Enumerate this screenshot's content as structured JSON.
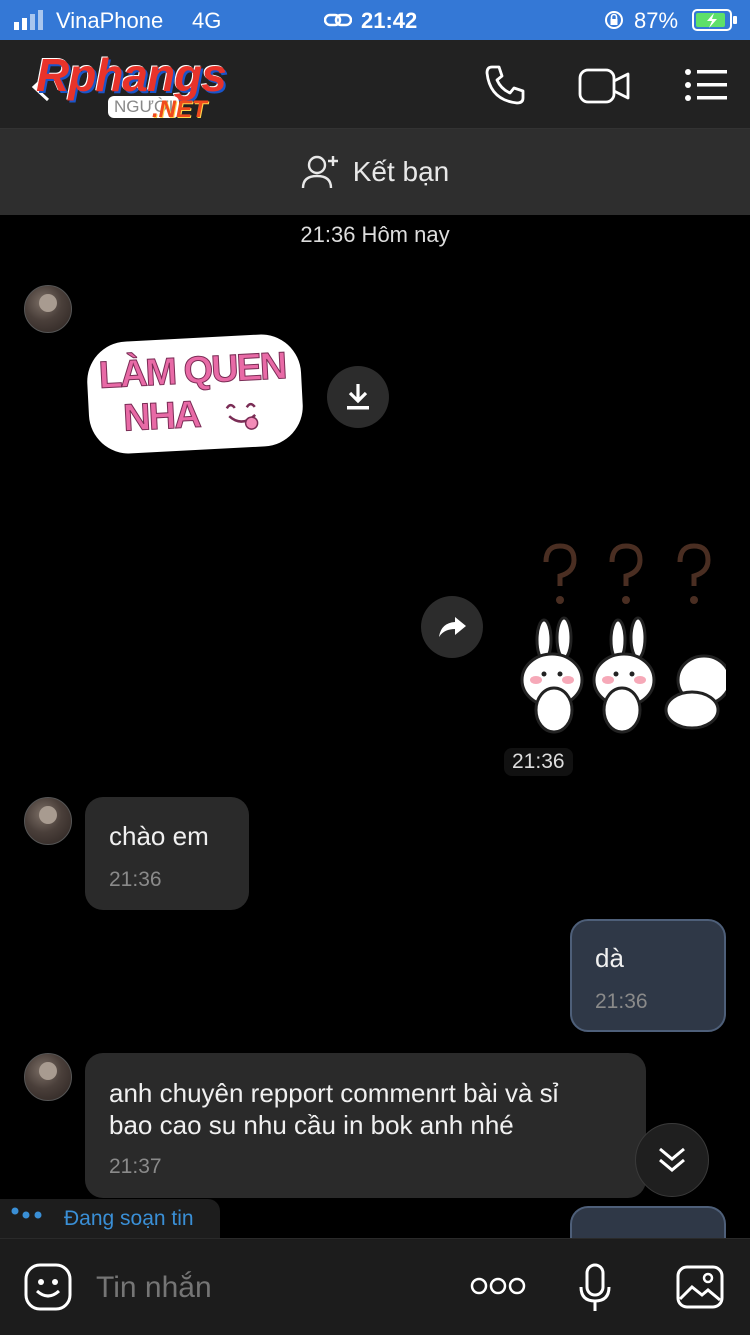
{
  "status": {
    "carrier": "VinaPhone",
    "network": "4G",
    "time": "21:42",
    "battery": "87%"
  },
  "header": {
    "logo_main": "Rphangs",
    "logo_sub": "NGƯỜI",
    "logo_net": ".NET"
  },
  "friend_bar": {
    "label": "Kết bạn"
  },
  "conversation": {
    "date_separator": "21:36 Hôm nay",
    "sticker_in_text_line1": "LÀM QUEN",
    "sticker_in_text_line2": "NHA",
    "sticker_out_time": "21:36",
    "messages": [
      {
        "text": "chào em",
        "time": "21:36"
      },
      {
        "text": "dà",
        "time": "21:36"
      },
      {
        "text_line1": "anh chuyên repport commenrt bài và sỉ",
        "text_line2": "bao cao su nhu cầu in bok anh nhé",
        "time": "21:37"
      }
    ]
  },
  "typing_indicator": "Đang soạn tin",
  "composer": {
    "placeholder": "Tin nhắn"
  },
  "colors": {
    "status_bar": "#3478d6",
    "outgoing_bubble": "#2f3847",
    "incoming_bubble": "#2a2a2a",
    "typing_text": "#3a8fd6"
  }
}
